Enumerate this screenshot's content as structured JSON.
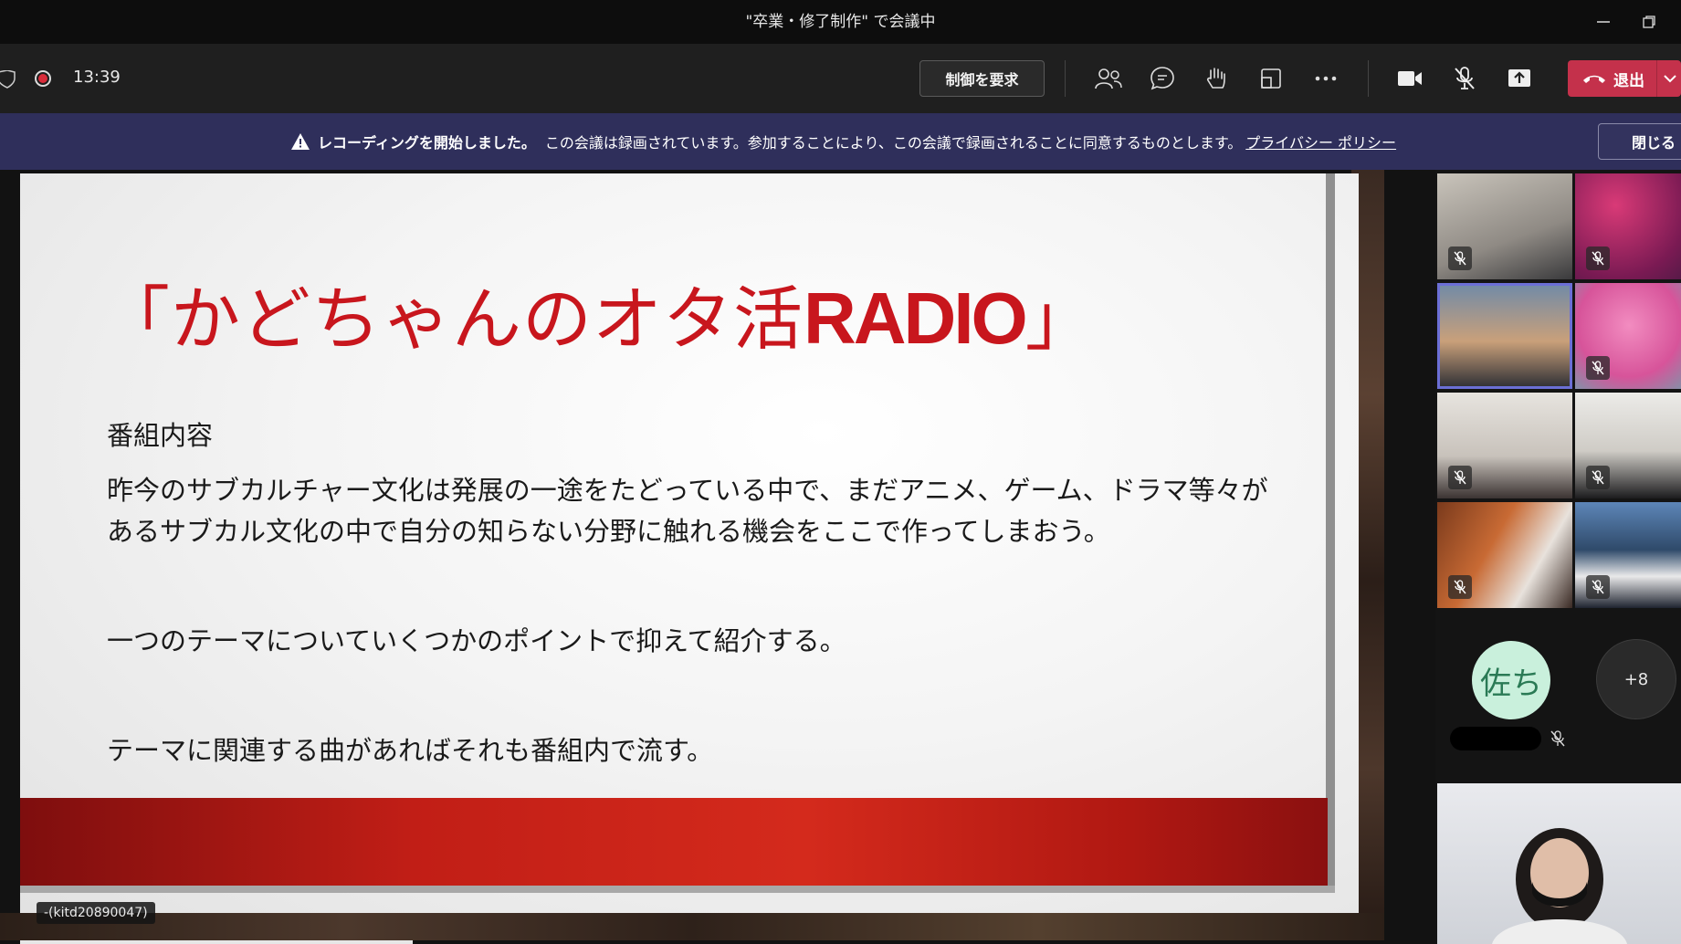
{
  "window": {
    "title": "\"卒業・修了制作\" で会議中"
  },
  "toolbar": {
    "timer": "13:39",
    "take_control_label": "制御を要求",
    "leave_label": "退出",
    "icons": [
      "people-icon",
      "chat-icon",
      "raise-hand-icon",
      "rooms-icon",
      "more-icon",
      "camera-icon",
      "mic-off-icon",
      "share-icon"
    ]
  },
  "banner": {
    "bold_text": "レコーディングを開始しました。",
    "message": "この会議は録画されています。参加することにより、この会議で録画されることに同意するものとします。",
    "link": "プライバシー ポリシー",
    "close_label": "閉じる"
  },
  "slide": {
    "title_open": "「",
    "title_main": "かどちゃんのオタ活",
    "title_bold": "RADIO",
    "title_close": "」",
    "heading": "番組内容",
    "line1": "昨今のサブカルチャー文化は発展の一途をたどっている中で、まだアニメ、ゲーム、ドラマ等々が",
    "line2": "あるサブカル文化の中で自分の知らない分野に触れる機会をここで作ってしまおう。",
    "line3": "一つのテーマについていくつかのポイントで抑えて紹介する。",
    "line4": "テーマに関連する曲があればそれも番組内で流す。"
  },
  "presenter": {
    "label": "-(kitd20890047)"
  },
  "participants": {
    "avatar_initials": "佐ち",
    "overflow_count": "+8"
  },
  "colors": {
    "leave": "#c4314b",
    "banner": "#2f2f5b",
    "slide_title": "#c8161d",
    "record": "#d92c3a"
  }
}
